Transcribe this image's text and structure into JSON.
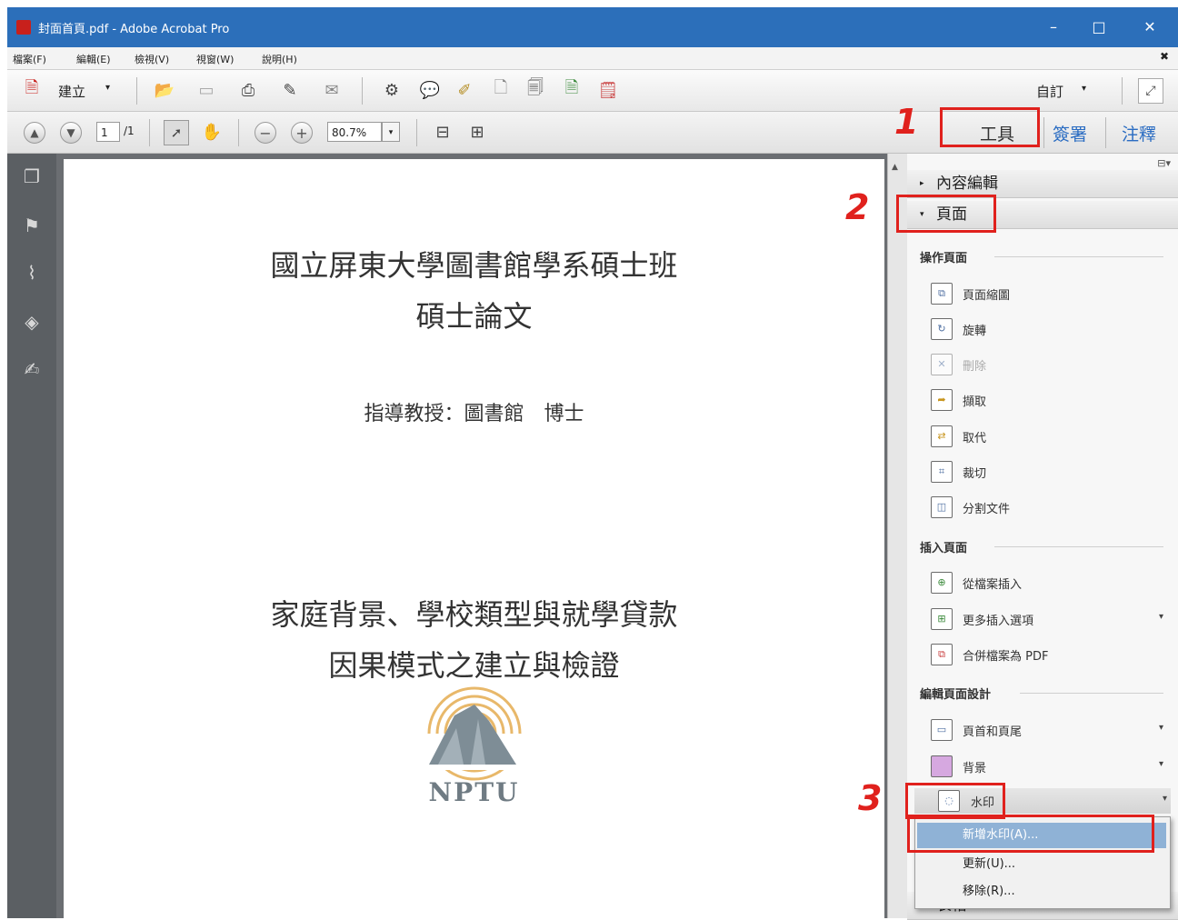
{
  "window": {
    "title": "封面首頁.pdf - Adobe Acrobat Pro",
    "minimize": "–",
    "maximize": "□",
    "close": "✕"
  },
  "menubar": {
    "items": [
      "檔案(F)",
      "編輯(E)",
      "檢視(V)",
      "視窗(W)",
      "說明(H)"
    ],
    "close": "✖"
  },
  "toolbar1": {
    "create_label": "建立",
    "customize_label": "自訂"
  },
  "toolbar2": {
    "page_current": "1",
    "page_total": "/1",
    "zoom": "80.7%"
  },
  "tabs": {
    "tools": "工具",
    "sign": "簽署",
    "comment": "注釋"
  },
  "document": {
    "line1": "國立屏東大學圖書館學系碩士班",
    "line2": "碩士論文",
    "advisor": "指導教授：圖書館　博士",
    "thesis_title_1": "家庭背景、學校類型與就學貸款",
    "thesis_title_2": "因果模式之建立與檢證",
    "logo_text": "NPTU"
  },
  "panel": {
    "section_content_edit": "內容編輯",
    "section_pages": "頁面",
    "section_forms": "表格",
    "groups": {
      "manipulate": "操作頁面",
      "insert": "插入頁面",
      "design": "編輯頁面設計"
    },
    "manipulate_items": [
      "頁面縮圖",
      "旋轉",
      "刪除",
      "擷取",
      "取代",
      "裁切",
      "分割文件"
    ],
    "insert_items": [
      "從檔案插入",
      "更多插入選項",
      "合併檔案為 PDF"
    ],
    "design_items": [
      "頁首和頁尾",
      "背景",
      "水印"
    ]
  },
  "watermark_menu": [
    "新增水印(A)...",
    "更新(U)...",
    "移除(R)..."
  ],
  "annotations": [
    "1",
    "2",
    "3"
  ],
  "colors": {
    "titlebar": "#2c6fba",
    "annotation_red": "#e0211d",
    "menu_highlight": "#8fb2d6"
  }
}
